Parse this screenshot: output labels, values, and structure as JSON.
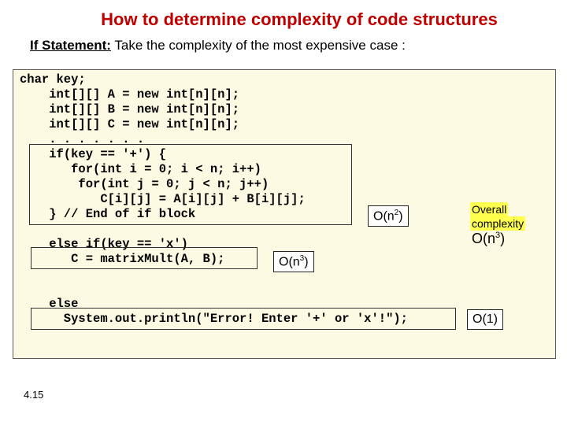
{
  "title": "How to determine complexity of code structures",
  "subtitle_bold": "If Statement:",
  "subtitle_rest": " Take the complexity of the most expensive case :",
  "code": {
    "l1": "char key;",
    "l2": "    int[][] A = new int[n][n];",
    "l3": "    int[][] B = new int[n][n];",
    "l4": "    int[][] C = new int[n][n];",
    "l5": "    . . . . . . .",
    "l6": "    if(key == '+') {",
    "l7": "       for(int i = 0; i < n; i++)",
    "l8": "        for(int j = 0; j < n; j++)",
    "l9": "           C[i][j] = A[i][j] + B[i][j];",
    "l10": "    } // End of if block",
    "l11": "",
    "l12": "    else if(key == 'x')",
    "l13": "       C = matrixMult(A, B);",
    "l14": "",
    "l15": "    else",
    "l16": "      System.out.println(\"Error! Enter '+' or 'x'!\");"
  },
  "badges": {
    "on2_html": "O(n<sup>2</sup>)",
    "on3_html": "O(n<sup>3</sup>)",
    "o1": "O(1)"
  },
  "overall": {
    "label": "Overall complexity",
    "value_html": "O(n<sup>3</sup>)"
  },
  "page": "4.15"
}
